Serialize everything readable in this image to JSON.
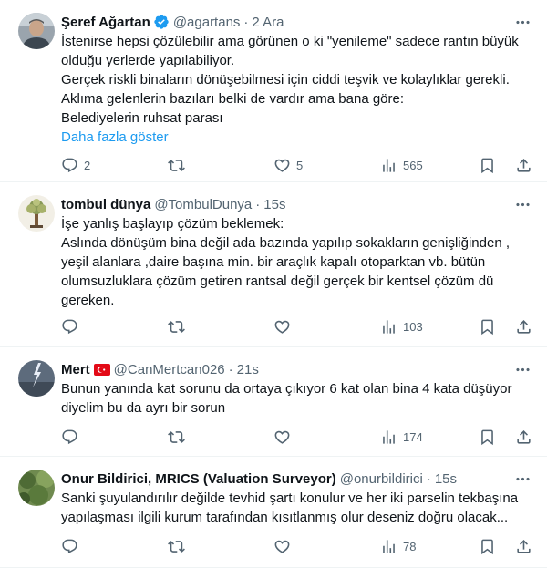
{
  "tweets": [
    {
      "name": "Şeref Ağartan",
      "handle": "@agartans",
      "dot": "·",
      "time": "2 Ara",
      "lines": [
        "İstenirse hepsi çözülebilir ama görünen o ki \"yenileme\" sadece rantın büyük",
        "olduğu yerlerde yapılabiliyor.",
        "Gerçek riskli binaların dönüşebilmesi için ciddi teşvik ve kolaylıklar gerekli.",
        "Aklıma gelenlerin bazıları belki de vardır ama bana göre:",
        "Belediyelerin ruhsat parası"
      ],
      "show_more": "Daha fazla göster",
      "replies": "2",
      "retweets": "",
      "likes": "5",
      "views": "565"
    },
    {
      "name": "tombul dünya",
      "handle": "@TombulDunya",
      "dot": "·",
      "time": "15s",
      "lines": [
        "İşe yanlış başlayıp çözüm beklemek:",
        "Aslında dönüşüm bina değil ada bazında yapılıp sokakların genişliğinden ,",
        "yeşil alanlara ,daire başına min. bir araçlık kapalı otoparktan vb. bütün",
        "olumsuzluklara çözüm getiren rantsal değil gerçek bir kentsel çözüm dü",
        "gereken."
      ],
      "replies": "",
      "retweets": "",
      "likes": "",
      "views": "103"
    },
    {
      "name": "Mert",
      "handle": "@CanMertcan026",
      "dot": "·",
      "time": "21s",
      "lines": [
        "Bunun yanında kat sorunu da ortaya çıkıyor 6 kat olan bina 4 kata düşüyor",
        "diyelim bu da ayrı bir sorun"
      ],
      "replies": "",
      "retweets": "",
      "likes": "",
      "views": "174"
    },
    {
      "name": "Onur Bildirici, MRICS (Valuation Surveyor)",
      "handle": "@onurbildirici",
      "dot": "·",
      "time": "15s",
      "lines": [
        "Sanki şuyulandırılır değilde tevhid şartı konulur ve her iki parselin tekbaşına",
        "yapılaşması ilgili kurum tarafından kısıtlanmış olur deseniz doğru olacak..."
      ],
      "replies": "",
      "retweets": "",
      "likes": "",
      "views": "78"
    }
  ],
  "colors": {
    "accent": "#1d9bf0",
    "muted": "#536471",
    "text": "#0f1419"
  },
  "icons": [
    "verified-badge-icon",
    "turkey-flag-icon",
    "more-icon",
    "reply-icon",
    "retweet-icon",
    "like-icon",
    "views-icon",
    "bookmark-icon",
    "share-icon"
  ]
}
